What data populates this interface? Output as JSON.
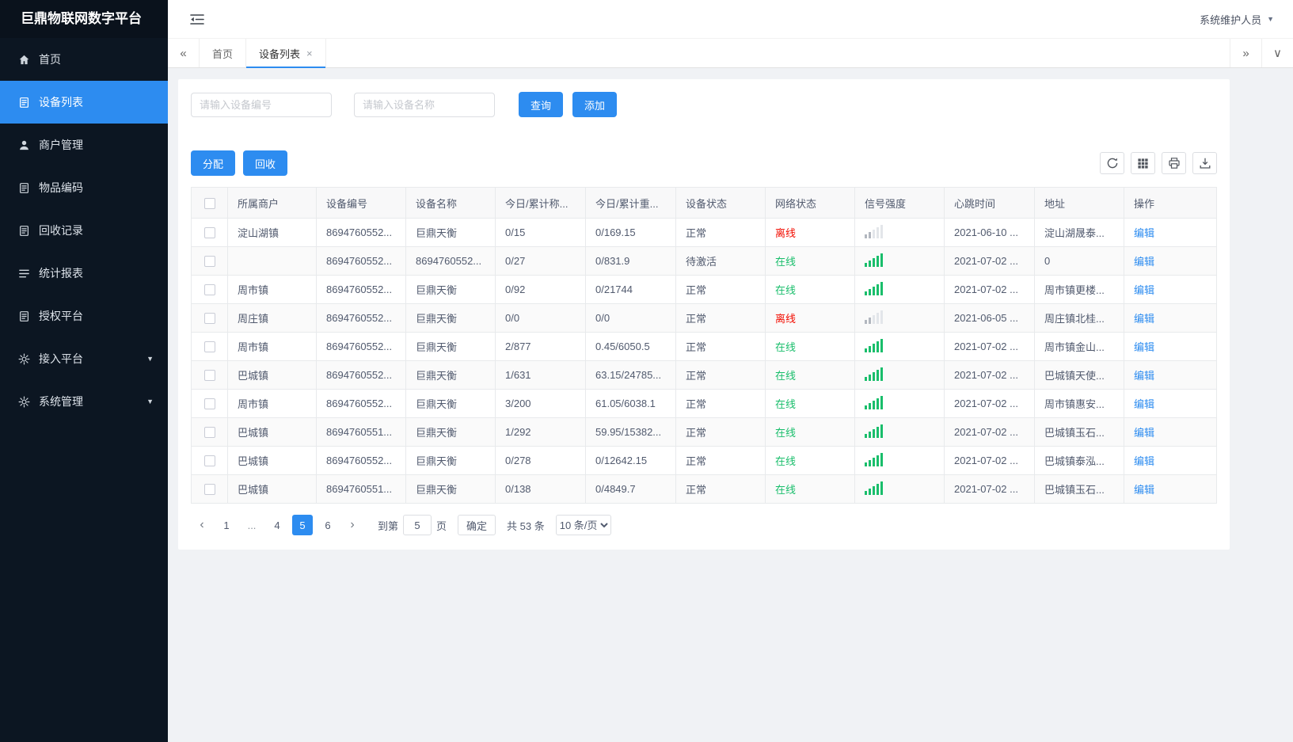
{
  "app": {
    "title": "巨鼎物联网数字平台",
    "user_role": "系统维护人员"
  },
  "colors": {
    "primary": "#2d8cf0",
    "online_green": "#19be6b",
    "offline_red": "#f20c00",
    "sidebar_bg": "#0c1622"
  },
  "sidebar": {
    "items": [
      {
        "label": "首页",
        "name": "home",
        "icon": "home-icon",
        "active": false,
        "expandable": false
      },
      {
        "label": "设备列表",
        "name": "device-list",
        "icon": "list-icon",
        "active": true,
        "expandable": false
      },
      {
        "label": "商户管理",
        "name": "merchant-management",
        "icon": "user-icon",
        "active": false,
        "expandable": false
      },
      {
        "label": "物品编码",
        "name": "item-code",
        "icon": "doc-icon",
        "active": false,
        "expandable": false
      },
      {
        "label": "回收记录",
        "name": "recycle-record",
        "icon": "doc-icon",
        "active": false,
        "expandable": false
      },
      {
        "label": "统计报表",
        "name": "statistics-report",
        "icon": "chart-lines-icon",
        "active": false,
        "expandable": false
      },
      {
        "label": "授权平台",
        "name": "authorization-platform",
        "icon": "doc-icon",
        "active": false,
        "expandable": false
      },
      {
        "label": "接入平台",
        "name": "access-platform",
        "icon": "gear-icon",
        "active": false,
        "expandable": true
      },
      {
        "label": "系统管理",
        "name": "system-management",
        "icon": "gear-icon",
        "active": false,
        "expandable": true
      }
    ]
  },
  "tabs": {
    "items": [
      {
        "label": "首页",
        "active": false,
        "closable": false
      },
      {
        "label": "设备列表",
        "active": true,
        "closable": true
      }
    ]
  },
  "search": {
    "device_no_placeholder": "请输入设备编号",
    "device_name_placeholder": "请输入设备名称",
    "query_label": "查询",
    "add_label": "添加"
  },
  "toolbar": {
    "assign_label": "分配",
    "recycle_label": "回收"
  },
  "table": {
    "headers": [
      "所属商户",
      "设备编号",
      "设备名称",
      "今日/累计称...",
      "今日/累计重...",
      "设备状态",
      "网络状态",
      "信号强度",
      "心跳时间",
      "地址",
      "操作"
    ],
    "edit_label": "编辑",
    "rows": [
      {
        "merchant": "淀山湖镇",
        "device_no": "8694760552...",
        "device_name": "巨鼎天衡",
        "today_count": "0/15",
        "today_weight": "0/169.15",
        "status": "正常",
        "network": "离线",
        "online": false,
        "signal": "weak",
        "heartbeat": "2021-06-10 ...",
        "address": "淀山湖晟泰..."
      },
      {
        "merchant": "",
        "device_no": "8694760552...",
        "device_name": "8694760552...",
        "today_count": "0/27",
        "today_weight": "0/831.9",
        "status": "待激活",
        "network": "在线",
        "online": true,
        "signal": "strong",
        "heartbeat": "2021-07-02 ...",
        "address": "0"
      },
      {
        "merchant": "周市镇",
        "device_no": "8694760552...",
        "device_name": "巨鼎天衡",
        "today_count": "0/92",
        "today_weight": "0/21744",
        "status": "正常",
        "network": "在线",
        "online": true,
        "signal": "strong",
        "heartbeat": "2021-07-02 ...",
        "address": "周市镇更楼..."
      },
      {
        "merchant": "周庄镇",
        "device_no": "8694760552...",
        "device_name": "巨鼎天衡",
        "today_count": "0/0",
        "today_weight": "0/0",
        "status": "正常",
        "network": "离线",
        "online": false,
        "signal": "weak",
        "heartbeat": "2021-06-05 ...",
        "address": "周庄镇北桂..."
      },
      {
        "merchant": "周市镇",
        "device_no": "8694760552...",
        "device_name": "巨鼎天衡",
        "today_count": "2/877",
        "today_weight": "0.45/6050.5",
        "status": "正常",
        "network": "在线",
        "online": true,
        "signal": "strong",
        "heartbeat": "2021-07-02 ...",
        "address": "周市镇金山..."
      },
      {
        "merchant": "巴城镇",
        "device_no": "8694760552...",
        "device_name": "巨鼎天衡",
        "today_count": "1/631",
        "today_weight": "63.15/24785...",
        "status": "正常",
        "network": "在线",
        "online": true,
        "signal": "strong",
        "heartbeat": "2021-07-02 ...",
        "address": "巴城镇天使..."
      },
      {
        "merchant": "周市镇",
        "device_no": "8694760552...",
        "device_name": "巨鼎天衡",
        "today_count": "3/200",
        "today_weight": "61.05/6038.1",
        "status": "正常",
        "network": "在线",
        "online": true,
        "signal": "strong",
        "heartbeat": "2021-07-02 ...",
        "address": "周市镇惠安..."
      },
      {
        "merchant": "巴城镇",
        "device_no": "8694760551...",
        "device_name": "巨鼎天衡",
        "today_count": "1/292",
        "today_weight": "59.95/15382...",
        "status": "正常",
        "network": "在线",
        "online": true,
        "signal": "strong",
        "heartbeat": "2021-07-02 ...",
        "address": "巴城镇玉石..."
      },
      {
        "merchant": "巴城镇",
        "device_no": "8694760552...",
        "device_name": "巨鼎天衡",
        "today_count": "0/278",
        "today_weight": "0/12642.15",
        "status": "正常",
        "network": "在线",
        "online": true,
        "signal": "strong",
        "heartbeat": "2021-07-02 ...",
        "address": "巴城镇泰泓..."
      },
      {
        "merchant": "巴城镇",
        "device_no": "8694760551...",
        "device_name": "巨鼎天衡",
        "today_count": "0/138",
        "today_weight": "0/4849.7",
        "status": "正常",
        "network": "在线",
        "online": true,
        "signal": "strong",
        "heartbeat": "2021-07-02 ...",
        "address": "巴城镇玉石..."
      }
    ]
  },
  "pagination": {
    "pages": [
      {
        "label": "1"
      },
      {
        "label": "...",
        "ellipsis": true
      },
      {
        "label": "4"
      },
      {
        "label": "5",
        "active": true
      },
      {
        "label": "6"
      }
    ],
    "goto_label": "到第",
    "goto_value": "5",
    "page_unit": "页",
    "confirm_label": "确定",
    "total_label": "共 53 条",
    "page_size": "10 条/页"
  }
}
